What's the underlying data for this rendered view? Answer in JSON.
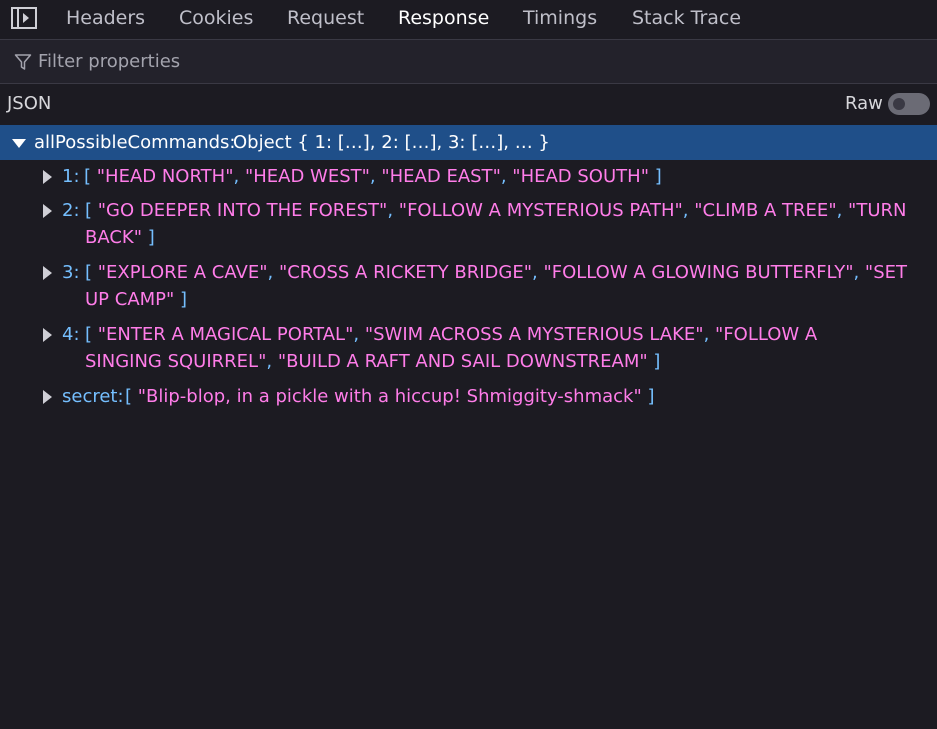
{
  "tabs": [
    {
      "label": "Headers"
    },
    {
      "label": "Cookies"
    },
    {
      "label": "Request"
    },
    {
      "label": "Response"
    },
    {
      "label": "Timings"
    },
    {
      "label": "Stack Trace"
    }
  ],
  "active_tab": "Response",
  "filter": {
    "placeholder": "Filter properties",
    "value": ""
  },
  "json_label": "JSON",
  "raw": {
    "label": "Raw",
    "enabled": false
  },
  "root": {
    "key": "allPossibleCommands:",
    "summary": "Object { 1: […], 2: […], 3: […], … }",
    "expanded": true
  },
  "items": [
    {
      "key": "1:",
      "values": [
        "HEAD NORTH",
        "HEAD WEST",
        "HEAD EAST",
        "HEAD SOUTH"
      ]
    },
    {
      "key": "2:",
      "values": [
        "GO DEEPER INTO THE FOREST",
        "FOLLOW A MYSTERIOUS PATH",
        "CLIMB A TREE",
        "TURN BACK"
      ]
    },
    {
      "key": "3:",
      "values": [
        "EXPLORE A CAVE",
        "CROSS A RICKETY BRIDGE",
        "FOLLOW A GLOWING BUTTERFLY",
        "SET UP CAMP"
      ]
    },
    {
      "key": "4:",
      "values": [
        "ENTER A MAGICAL PORTAL",
        "SWIM ACROSS A MYSTERIOUS LAKE",
        "FOLLOW A SINGING SQUIRREL",
        "BUILD A RAFT AND SAIL DOWNSTREAM"
      ]
    },
    {
      "key": "secret:",
      "values": [
        "Blip-blop, in a pickle with a hiccup! Shmiggity-shmack"
      ]
    }
  ],
  "colors": {
    "background": "#1c1b22",
    "selected_row": "#1f4f89",
    "key": "#75bfff",
    "string": "#ff7de9"
  }
}
